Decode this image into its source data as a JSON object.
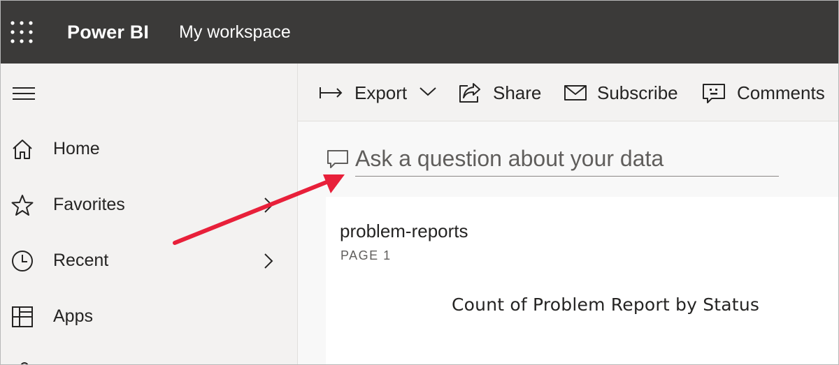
{
  "topbar": {
    "app_title": "Power BI",
    "workspace": "My workspace",
    "background_color": "#3b3a39"
  },
  "sidebar": {
    "items": [
      {
        "label": "Home",
        "icon": "home-icon",
        "has_chevron": false
      },
      {
        "label": "Favorites",
        "icon": "star-icon",
        "has_chevron": true
      },
      {
        "label": "Recent",
        "icon": "clock-icon",
        "has_chevron": true
      },
      {
        "label": "Apps",
        "icon": "apps-icon",
        "has_chevron": false
      }
    ]
  },
  "toolbar": {
    "export_label": "Export",
    "share_label": "Share",
    "subscribe_label": "Subscribe",
    "comments_label": "Comments"
  },
  "qa": {
    "placeholder": "Ask a question about your data"
  },
  "report": {
    "title": "problem-reports",
    "page_label": "PAGE 1",
    "visual_title": "Count of Problem Report by Status"
  },
  "annotation": {
    "arrow_color": "#e8203a"
  }
}
